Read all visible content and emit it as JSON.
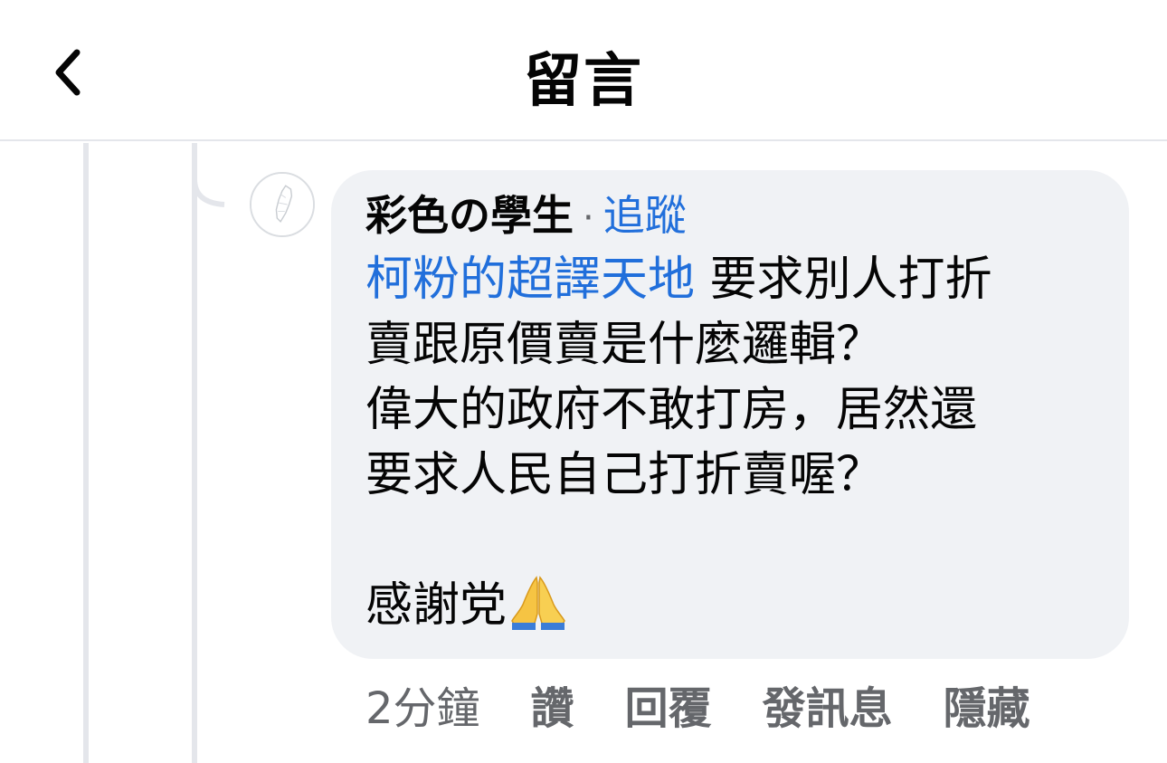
{
  "header": {
    "title": "留言",
    "back_icon": "chevron-left-icon"
  },
  "comment": {
    "author": "彩色の學生",
    "separator": "·",
    "follow_label": "追蹤",
    "mention": "柯粉的超譯天地",
    "line1_rest": " 要求別人打折",
    "line2": "賣跟原價賣是什麼邏輯？",
    "line3": "偉大的政府不敢打房，居然還",
    "line4": "要求人民自己打折賣喔？",
    "line5": "感謝党",
    "emoji": "folded-hands-icon"
  },
  "actions": {
    "timestamp": "2分鐘",
    "like": "讚",
    "reply": "回覆",
    "message": "發訊息",
    "hide": "隱藏"
  },
  "colors": {
    "link_blue": "#216fdb",
    "bubble_bg": "#f0f2f5",
    "meta_gray": "#65676b"
  }
}
